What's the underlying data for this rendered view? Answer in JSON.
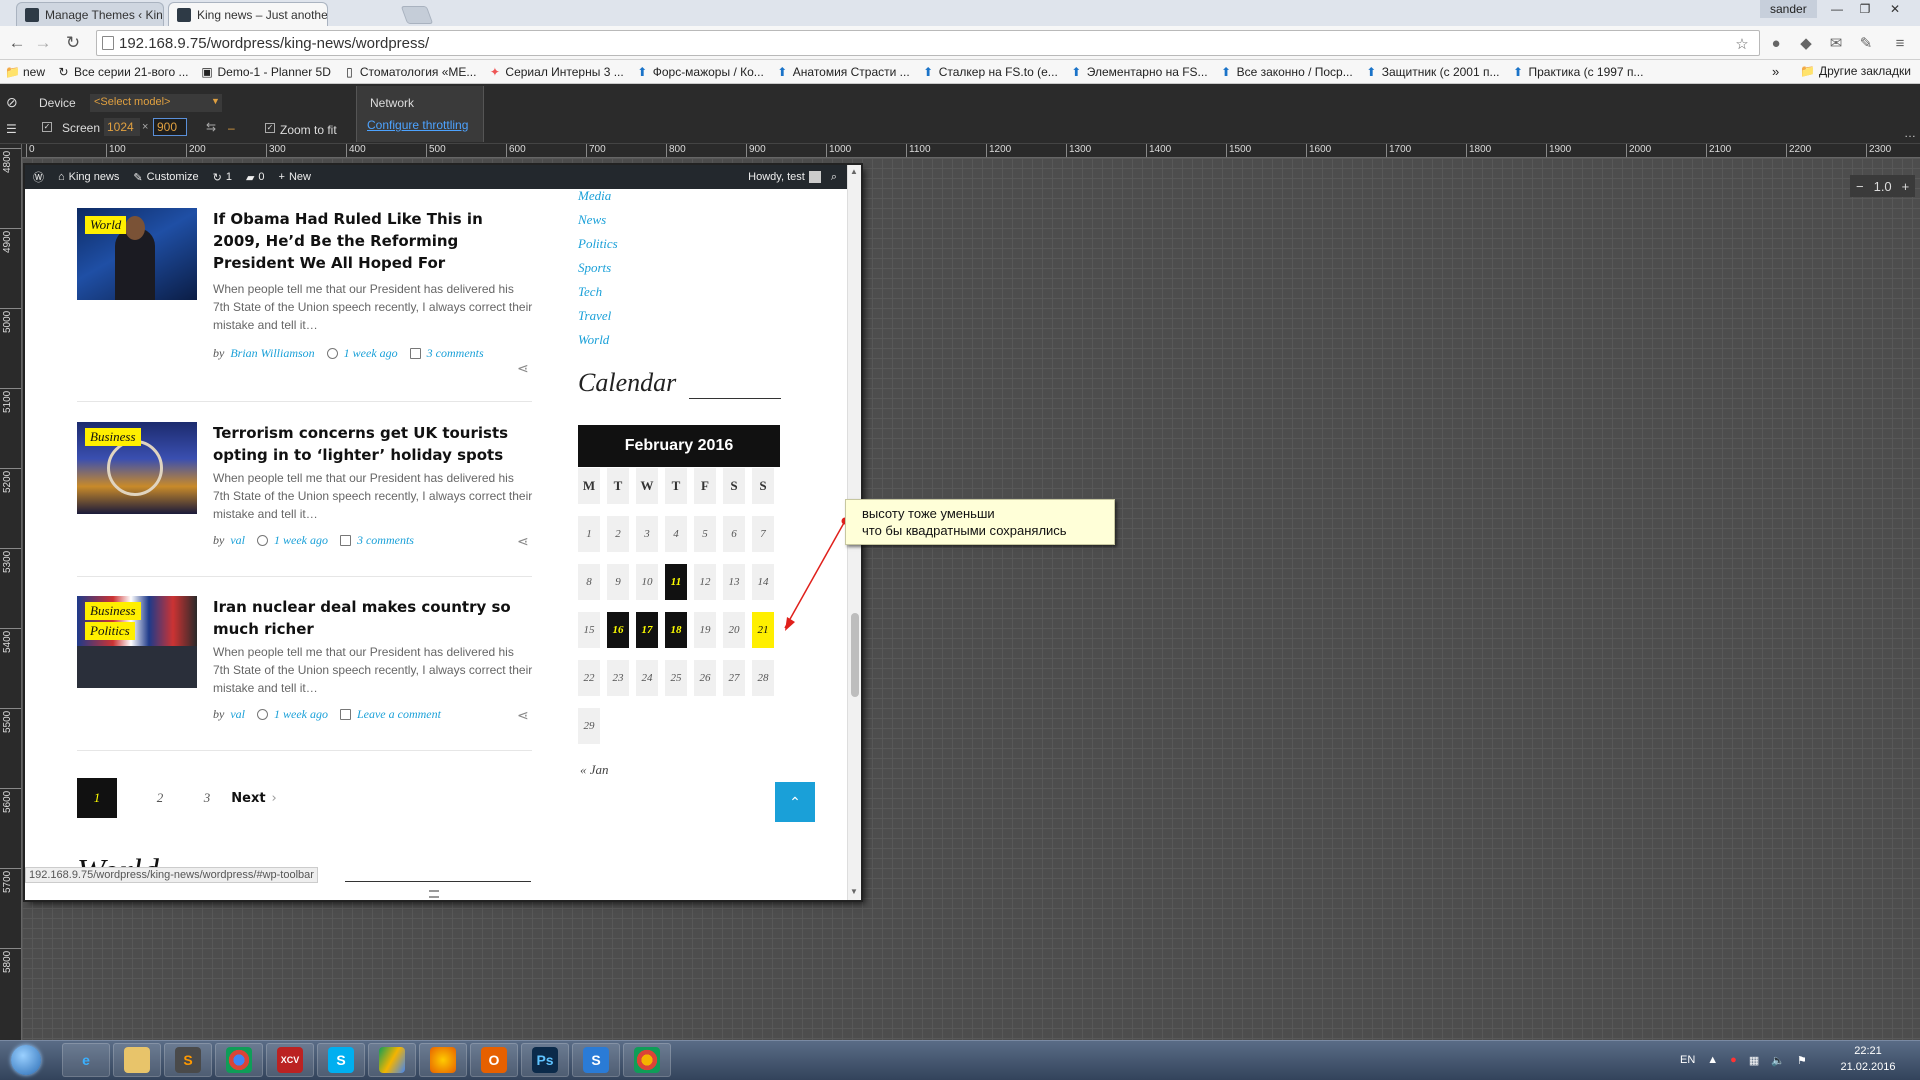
{
  "browser": {
    "tabs": [
      {
        "title": "Manage Themes ‹ King ne",
        "active": false
      },
      {
        "title": "King news – Just another \\",
        "active": true
      }
    ],
    "profile": "sander",
    "url": "192.168.9.75/wordpress/king-news/wordpress/",
    "bookmarks": [
      "new",
      "Все серии 21-вого ...",
      "Demo-1 - Planner 5D",
      "Стоматология «МЕ...",
      "Сериал Интерны 3 ...",
      "Форс-мажоры / Ко...",
      "Анатомия Страсти ...",
      "Сталкер на FS.to (е...",
      "Элементарно на FS...",
      "Все законно / Поср...",
      "Защитник (с 2001 п...",
      "Практика (с 1997 п..."
    ],
    "bookmarks_overflow": "»",
    "other_bookmarks": "Другие закладки"
  },
  "devtools": {
    "device_label": "Device",
    "model_select": "<Select model>",
    "screen_label": "Screen",
    "screen_width": "1024",
    "screen_x": "×",
    "screen_height": "900",
    "zoom_to_fit_label": "Zoom to fit",
    "network_label": "Network",
    "throttling_link": "Configure throttling",
    "zoom_value": "1.0",
    "ruler_top_labels": [
      "0",
      "100",
      "200",
      "300",
      "400",
      "500",
      "600",
      "700",
      "800",
      "900",
      "1000",
      "1100",
      "1200",
      "1300",
      "1400",
      "1500",
      "1600",
      "1700",
      "1800",
      "1900",
      "2000",
      "2100",
      "2200",
      "2300"
    ],
    "ruler_left_labels": [
      "4800",
      "4900",
      "5000",
      "5100",
      "5200",
      "5300",
      "5400",
      "5500",
      "5600",
      "5700",
      "5800"
    ]
  },
  "wp_admin_bar": {
    "site_name": "King news",
    "customize": "Customize",
    "updates_count": "1",
    "comments_count": "0",
    "new_label": "New",
    "howdy": "Howdy, test"
  },
  "posts": [
    {
      "categories": [
        "World"
      ],
      "title": "If Obama Had Ruled Like This in 2009, He’d Be the Reforming President We All Hoped For",
      "excerpt": "When people tell me that our President has delivered his 7th State of the Union speech recently, I always correct their mistake and tell it…",
      "by": "by",
      "author": "Brian Williamson",
      "date": "1 week ago",
      "comments": "3 comments"
    },
    {
      "categories": [
        "Business"
      ],
      "title": "Terrorism concerns get UK tourists opting in to ‘lighter’ holiday spots",
      "excerpt": "When people tell me that our President has delivered his 7th State of the Union speech recently, I always correct their mistake and tell it…",
      "by": "by",
      "author": "val",
      "date": "1 week ago",
      "comments": "3 comments"
    },
    {
      "categories": [
        "Business",
        "Politics"
      ],
      "title": "Iran nuclear deal makes country so much richer",
      "excerpt": "When people tell me that our President has delivered his 7th State of the Union speech recently, I always correct their mistake and tell it…",
      "by": "by",
      "author": "val",
      "date": "1 week ago",
      "comments": "Leave a comment"
    }
  ],
  "pagination": {
    "pages": [
      "1",
      "2",
      "3"
    ],
    "next": "Next"
  },
  "sidebar": {
    "categories": [
      "Media",
      "News",
      "Politics",
      "Sports",
      "Tech",
      "Travel",
      "World"
    ],
    "calendar_title": "Calendar",
    "calendar_month": "February 2016",
    "weekdays": [
      "M",
      "T",
      "W",
      "T",
      "F",
      "S",
      "S"
    ],
    "days": [
      "1",
      "2",
      "3",
      "4",
      "5",
      "6",
      "7",
      "8",
      "9",
      "10",
      "11",
      "12",
      "13",
      "14",
      "15",
      "16",
      "17",
      "18",
      "19",
      "20",
      "21",
      "22",
      "23",
      "24",
      "25",
      "26",
      "27",
      "28",
      "29"
    ],
    "days_with_posts": [
      "11",
      "16",
      "17",
      "18"
    ],
    "today": "21",
    "prev_month": "« Jan"
  },
  "section_header": "World",
  "status_url": "192.168.9.75/wordpress/king-news/wordpress/#wp-toolbar",
  "annotation": {
    "line1": "высоту тоже уменьши",
    "line2": "что бы квадратными сохранялись",
    "color": "#e0201b"
  },
  "colors": {
    "accent": "#1aa0d8",
    "highlight": "#ffef00"
  },
  "taskbar": {
    "apps": [
      "ie-icon",
      "explorer-icon",
      "sublime-icon",
      "chrome-icon",
      "filezilla-icon",
      "skype-icon",
      "drive-icon",
      "firefox-icon",
      "outlook-icon",
      "photoshop-icon",
      "skype-s-icon",
      "chrome-canary-icon"
    ],
    "app_labels": {
      "filezilla": "XCV",
      "photoshop": "Ps"
    },
    "lang": "EN",
    "time": "22:21",
    "date": "21.02.2016"
  }
}
